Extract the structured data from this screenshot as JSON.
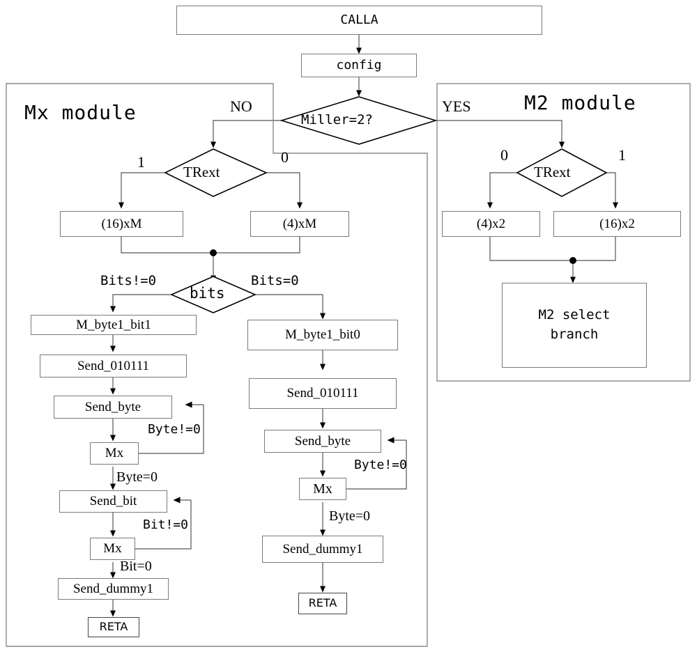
{
  "diagram": {
    "title_visible": false,
    "modules": [
      {
        "id": "mx",
        "label": "Mx module"
      },
      {
        "id": "m2",
        "label": "M2 module"
      }
    ],
    "top_flow": {
      "start": "CALLA",
      "config": "config",
      "decision": "Miller=2?",
      "branch_no": "NO",
      "branch_yes": "YES"
    },
    "mx_module": {
      "label": "Mx module",
      "trext_decision": "TRext",
      "trext_left_label": "1",
      "trext_right_label": "0",
      "left_rate": "(16)xM",
      "right_rate": "(4)xM",
      "bits_decision": "bits",
      "bits_left_label": "Bits!=0",
      "bits_right_label": "Bits=0",
      "left_branch": {
        "step1": "M_byte1_bit1",
        "step2": "Send_010111",
        "step3": "Send_byte",
        "step4": "Mx",
        "loop_label_1": "Byte!=0",
        "edge_label_1": "Byte=0",
        "step5": "Send_bit",
        "step6": "Mx",
        "loop_label_2": "Bit!=0",
        "edge_label_2": "Bit=0",
        "step7": "Send_dummy1",
        "step8": "RETA"
      },
      "right_branch": {
        "step1": "M_byte1_bit0",
        "step2": "Send_010111",
        "step3": "Send_byte",
        "step4": "Mx",
        "loop_label_1": "Byte!=0",
        "edge_label_1": "Byte=0",
        "step5": "Send_dummy1",
        "step6": "RETA"
      }
    },
    "m2_module": {
      "label": "M2 module",
      "trext_decision": "TRext",
      "trext_left_label": "0",
      "trext_right_label": "1",
      "left_rate": "(4)x2",
      "right_rate": "(16)x2",
      "result": "M2 select\nbranch",
      "result_line1": "M2 select",
      "result_line2": "branch"
    },
    "colors": {
      "stroke": "#000000",
      "box_border": "#7a7a7a",
      "background": "#ffffff"
    }
  }
}
